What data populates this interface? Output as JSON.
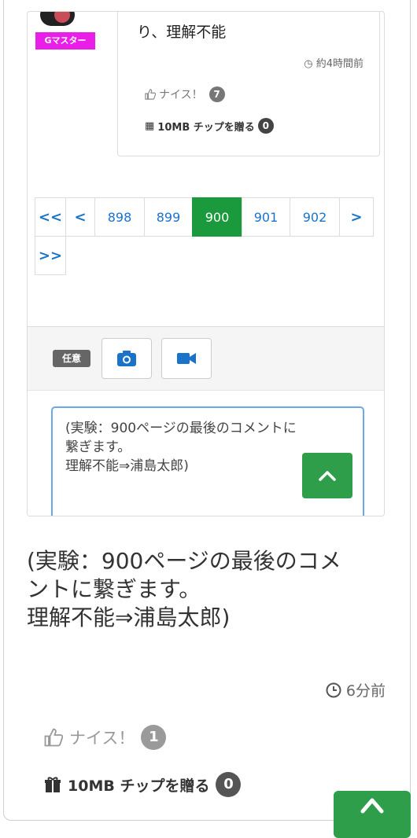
{
  "prev_comment": {
    "badge": "Gマスター",
    "text": "り、理解不能",
    "time": "約4時間前",
    "nice_label": "ナイス！",
    "nice_count": "7",
    "tip_label": "10MB チップを贈る",
    "tip_count": "0"
  },
  "pagination": {
    "first": "<<",
    "prev": "<",
    "pages": [
      "898",
      "899",
      "900",
      "901",
      "902"
    ],
    "active_page": "900",
    "next": ">",
    "last": ">>"
  },
  "form": {
    "optional_tag": "任意",
    "textarea_value": "(実験：900ページの最後のコメントに\n繋ぎます。\n理解不能⇒浦島太郎)"
  },
  "main_comment": {
    "text": "(実験：900ページの最後のコメ\nントに繋ぎます。\n理解不能⇒浦島太郎)",
    "time": "6分前",
    "nice_label": "ナイス！",
    "nice_count": "1",
    "tip_label": "10MB チップを贈る",
    "tip_count": "0"
  },
  "colors": {
    "accent_green": "#1a9a3c",
    "link_blue": "#1a73c8",
    "badge_magenta": "#e91ee8"
  }
}
